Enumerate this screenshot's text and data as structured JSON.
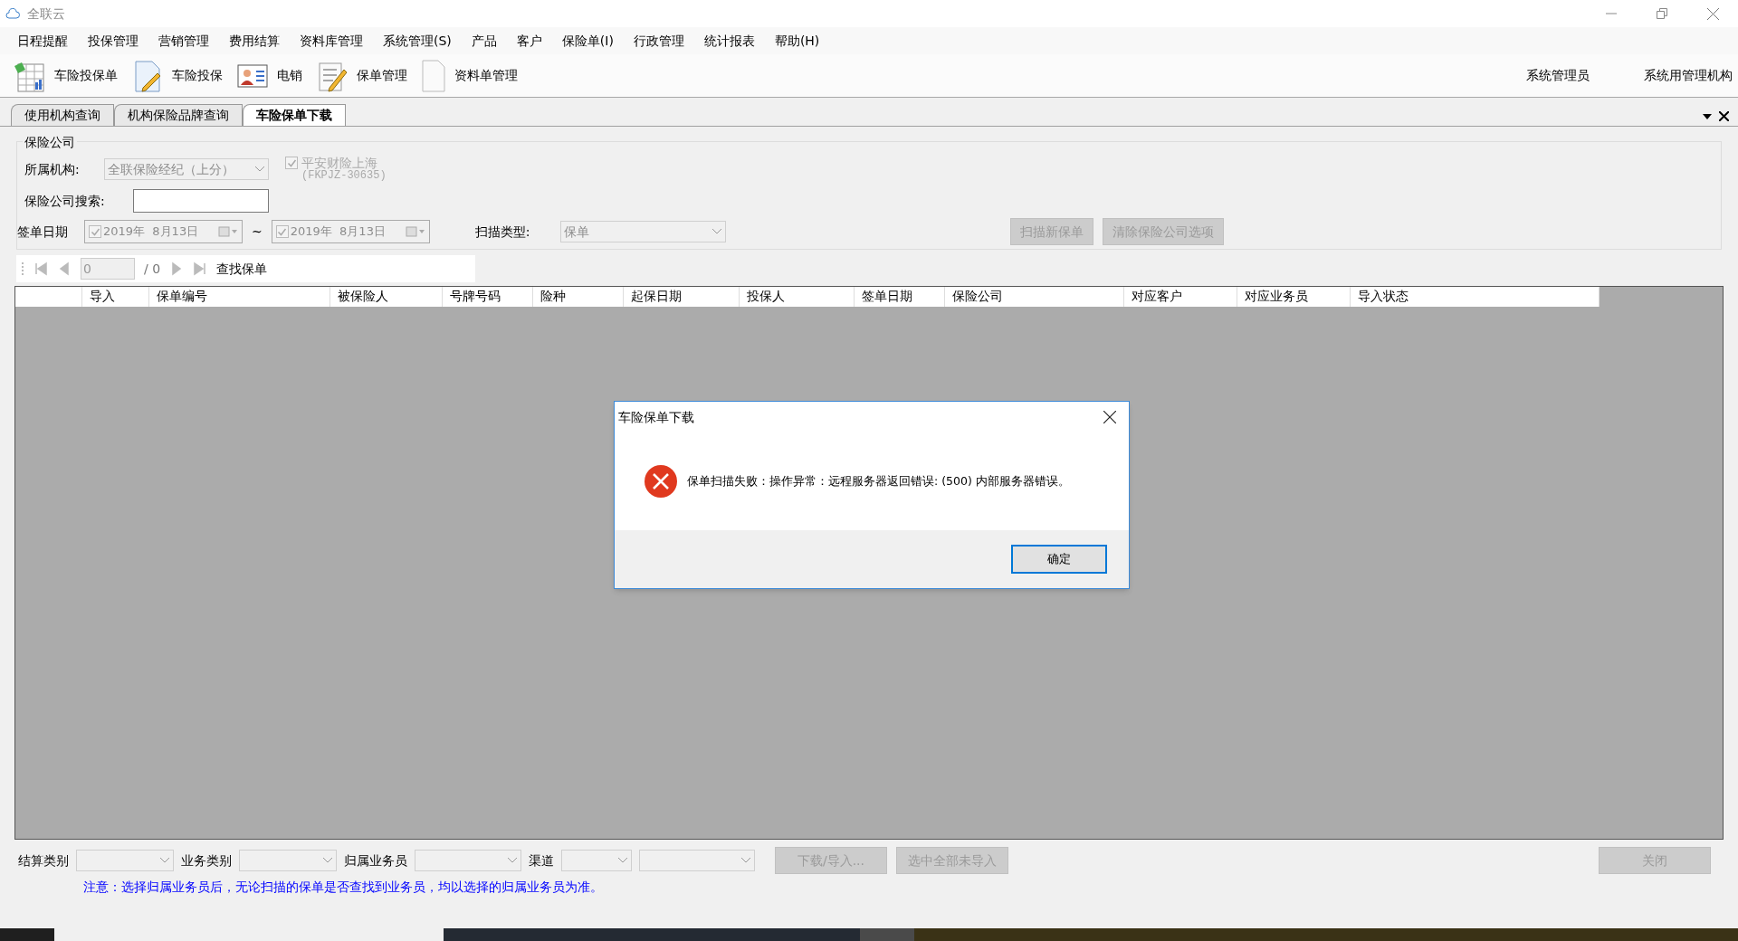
{
  "window": {
    "title": "全联云"
  },
  "menu": [
    "日程提醒",
    "投保管理",
    "营销管理",
    "费用结算",
    "资料库管理",
    "系统管理(S)",
    "产品",
    "客户",
    "保险单(I)",
    "行政管理",
    "统计报表",
    "帮助(H)"
  ],
  "toolbar": [
    {
      "kind": "sheet",
      "label": "车险投保单"
    },
    {
      "kind": "doc-pen",
      "label": "车险投保"
    },
    {
      "kind": "card",
      "label": "电销"
    },
    {
      "kind": "list-pen",
      "label": "保单管理"
    },
    {
      "kind": "page",
      "label": "资料单管理"
    }
  ],
  "user": {
    "name": "系统管理员",
    "org": "系统用管理机构"
  },
  "tabs": [
    {
      "label": "使用机构查询",
      "selected": false
    },
    {
      "label": "机构保险品牌查询",
      "selected": false
    },
    {
      "label": "车险保单下载",
      "selected": true
    }
  ],
  "form": {
    "group_title": "保险公司",
    "org_label": "所属机构:",
    "org_value": "全联保险经纪（上分）",
    "company_check": {
      "label": "平安财险上海",
      "code": "(FKPJZ-30635)",
      "checked": true,
      "disabled": true
    },
    "search_label": "保险公司搜索:",
    "date_label": "签单日期",
    "date_from": {
      "value": "2019年  8月13日",
      "checked": true
    },
    "range_sep": "~",
    "date_to": {
      "value": "2019年  8月13日",
      "checked": true
    },
    "scan_type_label": "扫描类型:",
    "scan_type_value": "保单",
    "buttons": [
      {
        "label": "扫描新保单",
        "disabled": true
      },
      {
        "label": "清除保险公司选项",
        "disabled": true
      }
    ]
  },
  "pager": {
    "page": "0",
    "total": "/ 0",
    "find": "查找保单"
  },
  "table": {
    "columns": [
      "导入",
      "保单编号",
      "被保险人",
      "号牌号码",
      "险种",
      "起保日期",
      "投保人",
      "签单日期",
      "保险公司",
      "对应客户",
      "对应业务员",
      "导入状态"
    ]
  },
  "bottom": {
    "fields": [
      {
        "label": "结算类别"
      },
      {
        "label": "业务类别"
      },
      {
        "label": "归属业务员"
      },
      {
        "label": "渠道"
      }
    ],
    "buttons": [
      {
        "label": "下载/导入...",
        "disabled": true
      },
      {
        "label": "选中全部未导入",
        "disabled": true
      }
    ],
    "close": {
      "label": "关闭",
      "disabled": true
    },
    "note": "注意：选择归属业务员后，无论扫描的保单是否查找到业务员，均以选择的归属业务员为准。"
  },
  "dialog": {
    "title": "车险保单下载",
    "message": "保单扫描失败：操作异常：远程服务器返回错误: (500) 内部服务器错误。",
    "ok": "确定"
  }
}
